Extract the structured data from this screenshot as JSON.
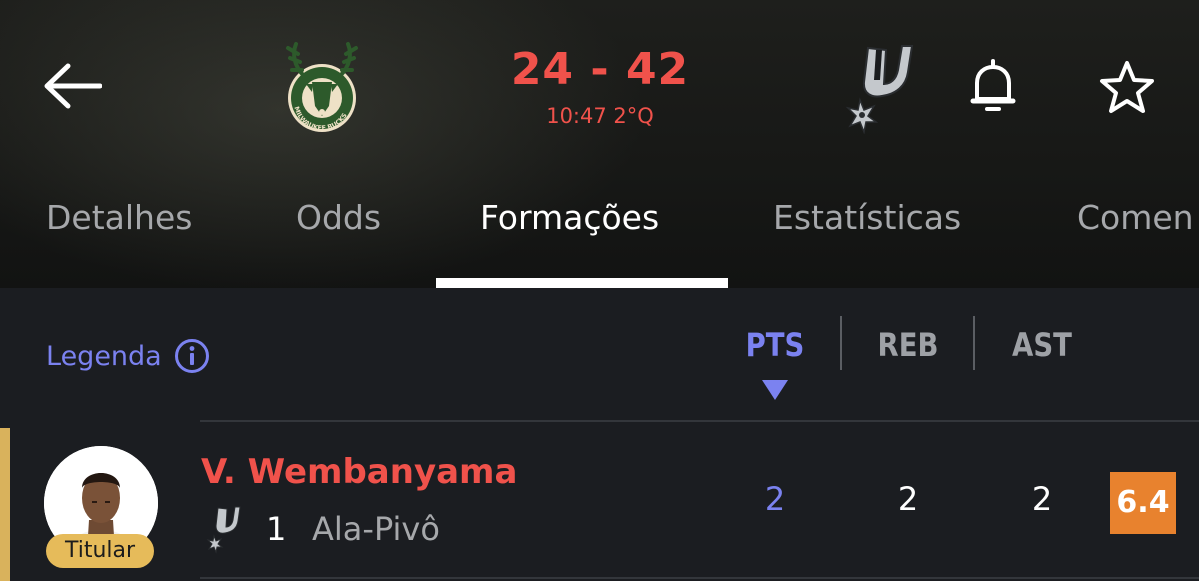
{
  "header": {
    "score": "24 - 42",
    "clock": "10:47 2°Q",
    "home_team_logo_text": "MILWAUKEE BUCKS",
    "icons": {
      "back": "arrow-left-icon",
      "bell": "bell-icon",
      "star": "star-icon"
    }
  },
  "tabs": [
    {
      "label": "Detalhes"
    },
    {
      "label": "Odds"
    },
    {
      "label": "Formações"
    },
    {
      "label": "Estatísticas"
    },
    {
      "label": "Comen"
    }
  ],
  "active_tab": "Formações",
  "legend": {
    "label": "Legenda",
    "icon": "info-icon"
  },
  "stat_columns": [
    "PTS",
    "REB",
    "AST"
  ],
  "sort_column": "PTS",
  "players": [
    {
      "name": "V. Wembanyama",
      "badge": "Titular",
      "number": "1",
      "position": "Ala-Pivô",
      "stats": {
        "pts": "2",
        "reb": "2",
        "ast": "2"
      },
      "rating": "6.4"
    }
  ],
  "colors": {
    "accent": "#7b82f0",
    "score": "#f0524b",
    "starter": "#e6bb5a",
    "rating": "#e8822e",
    "bucks_green": "#2d5a2b",
    "bucks_cream": "#eee1c6"
  }
}
